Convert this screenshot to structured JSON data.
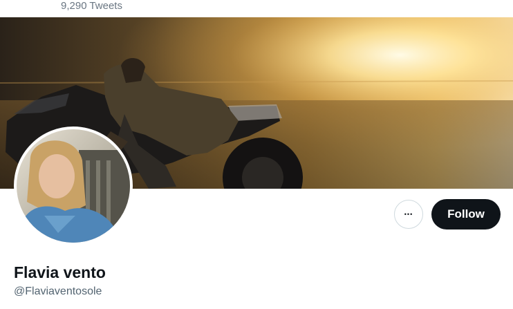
{
  "header": {
    "tweet_count": "9,290 Tweets"
  },
  "profile": {
    "display_name": "Flavia vento",
    "handle": "@Flaviaventosole"
  },
  "actions": {
    "more_icon": "more-horizontal-icon",
    "more_glyph": "•••",
    "follow_label": "Follow"
  },
  "colors": {
    "follow_bg": "#0f1419",
    "follow_text": "#ffffff",
    "name_text": "#0f1419",
    "handle_text": "#536471"
  }
}
